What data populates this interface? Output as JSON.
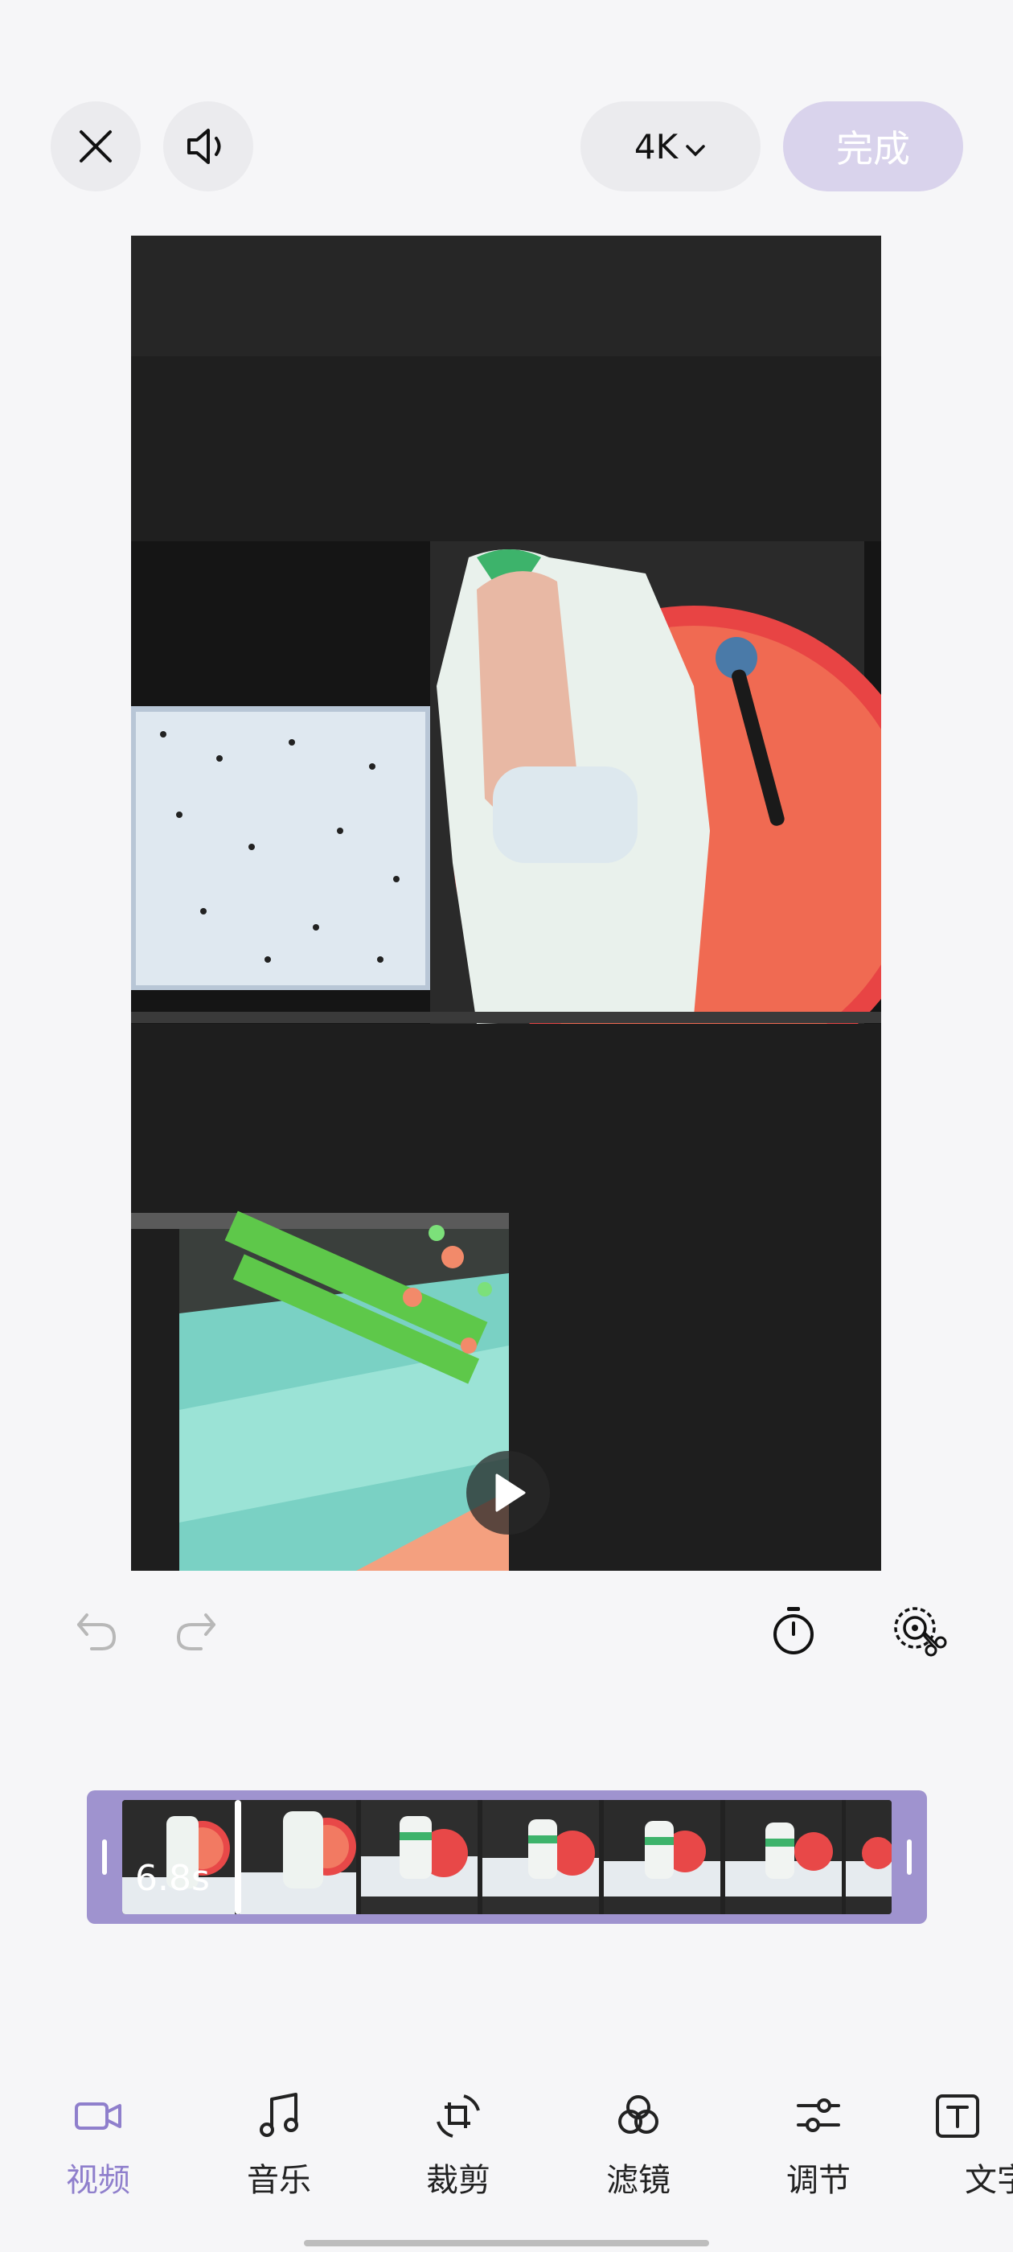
{
  "top_bar": {
    "resolution_label": "4K",
    "done_label": "完成"
  },
  "timeline": {
    "duration_label": "6.8s"
  },
  "bottom_nav": [
    {
      "label": "视频",
      "icon": "video-icon",
      "active": true
    },
    {
      "label": "音乐",
      "icon": "music-icon",
      "active": false
    },
    {
      "label": "裁剪",
      "icon": "crop-icon",
      "active": false
    },
    {
      "label": "滤镜",
      "icon": "filter-icon",
      "active": false
    },
    {
      "label": "调节",
      "icon": "adjust-icon",
      "active": false
    },
    {
      "label": "文字",
      "icon": "text-icon",
      "active": false
    }
  ],
  "colors": {
    "accent": "#9f93cf",
    "active_tab": "#8f7fcc",
    "done_button": "#d9d3ec"
  }
}
